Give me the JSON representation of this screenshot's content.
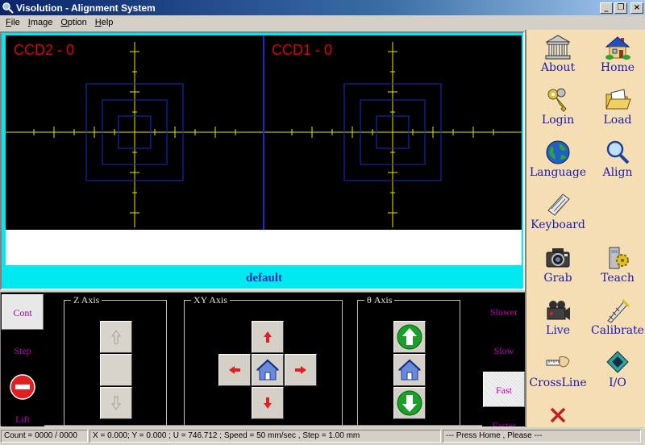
{
  "window": {
    "title": "Visolution - Alignment System",
    "min": "_",
    "max": "❐",
    "close": "×"
  },
  "menu": [
    {
      "label_hot": "F",
      "label_rest": "ile"
    },
    {
      "label_hot": "I",
      "label_rest": "mage"
    },
    {
      "label_hot": "O",
      "label_rest": "ption"
    },
    {
      "label_hot": "H",
      "label_rest": "elp"
    }
  ],
  "camera": {
    "left_label": "CCD2 - 0",
    "right_label": "CCD1 - 0",
    "profile": "default",
    "crosshair_color": "#e8e800",
    "box_color": "#1a2ad0",
    "divider_color": "#1a2ad0"
  },
  "controls": {
    "modes": [
      "Cont",
      "Step",
      "Lift"
    ],
    "active_mode": "Cont",
    "z_axis_title": "Z  Axis",
    "xy_axis_title": "XY  Axis",
    "theta_axis_title": "θ  Axis",
    "speeds": [
      "Slower",
      "Slow",
      "Fast",
      "Faster"
    ],
    "active_speed": "Fast"
  },
  "toolbar": {
    "about": "About",
    "home": "Home",
    "login": "Login",
    "load": "Load",
    "language": "Language",
    "align": "Align",
    "keyboard": "Keyboard",
    "grab": "Grab",
    "teach": "Teach",
    "live": "Live",
    "calibrate": "Calibrate",
    "crossline": "CrossLine",
    "io": "I/O"
  },
  "status": {
    "count": "Count = 0000 / 0000",
    "position": "X = 0.000; Y = 0.000 ; U = 746.712 ; Speed = 50 mm/sec , Step = 1.00 mm",
    "message": "--- Press Home , Please ---"
  }
}
